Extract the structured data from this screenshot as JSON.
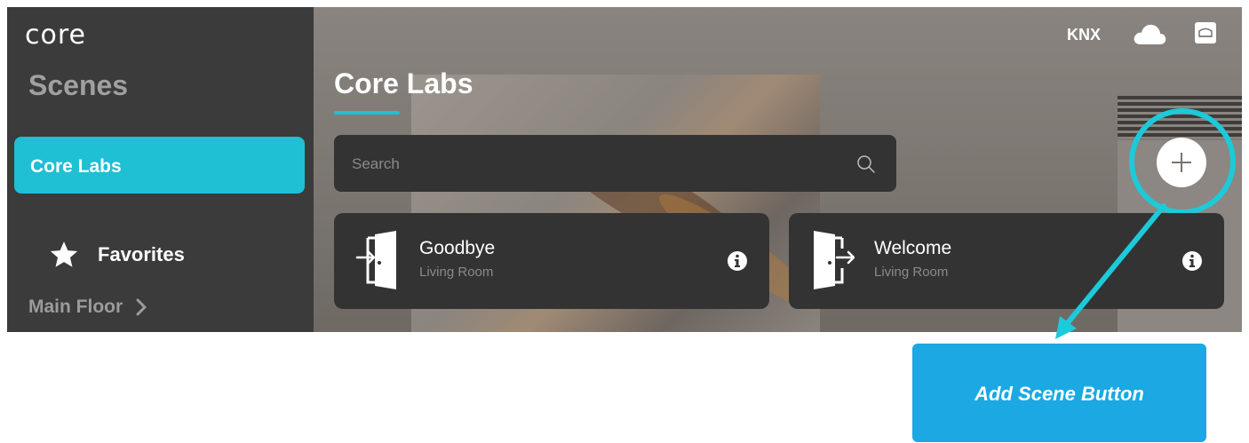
{
  "app": {
    "logo_text": "core"
  },
  "sidebar": {
    "title": "Scenes",
    "selected_home": "Core Labs",
    "favorites_label": "Favorites",
    "floor_label": "Main Floor"
  },
  "header": {
    "page_title": "Core Labs",
    "protocol_label": "KNX",
    "cloud_icon": "cloud-icon",
    "gateway_icon": "gateway-icon"
  },
  "search": {
    "placeholder": "Search",
    "value": ""
  },
  "scenes": [
    {
      "name": "Goodbye",
      "room": "Living Room",
      "icon": "door-exit-icon"
    },
    {
      "name": "Welcome",
      "room": "Living Room",
      "icon": "door-enter-icon"
    }
  ],
  "annotation": {
    "label": "Add Scene Button"
  },
  "colors": {
    "accent": "#1fbfd4",
    "callout": "#1ba8e3",
    "sidebar": "#3b3b3b",
    "card": "#333333"
  }
}
